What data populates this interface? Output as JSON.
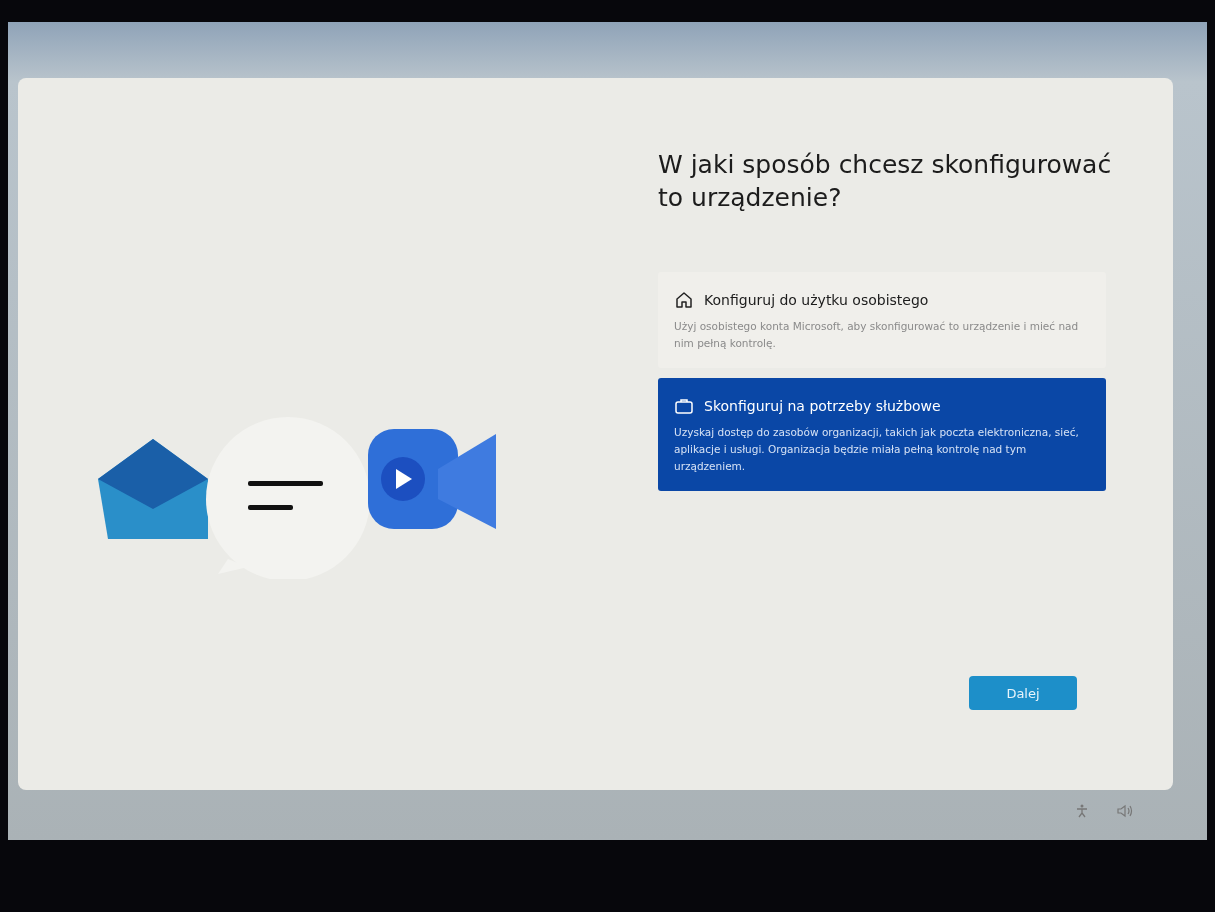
{
  "heading": "W jaki sposób chcesz skonfigurować to urządzenie?",
  "options": [
    {
      "kind": "home",
      "title": "Konfiguruj do użytku osobistego",
      "description": "Użyj osobistego konta Microsoft, aby skonfigurować to urządzenie i mieć nad nim pełną kontrolę.",
      "selected": false
    },
    {
      "kind": "work",
      "title": "Skonfiguruj na potrzeby służbowe",
      "description": "Uzyskaj dostęp do zasobów organizacji, takich jak poczta elektroniczna, sieć, aplikacje i usługi. Organizacja będzie miała pełną kontrolę nad tym urządzeniem.",
      "selected": true
    }
  ],
  "next_button": "Dalej"
}
